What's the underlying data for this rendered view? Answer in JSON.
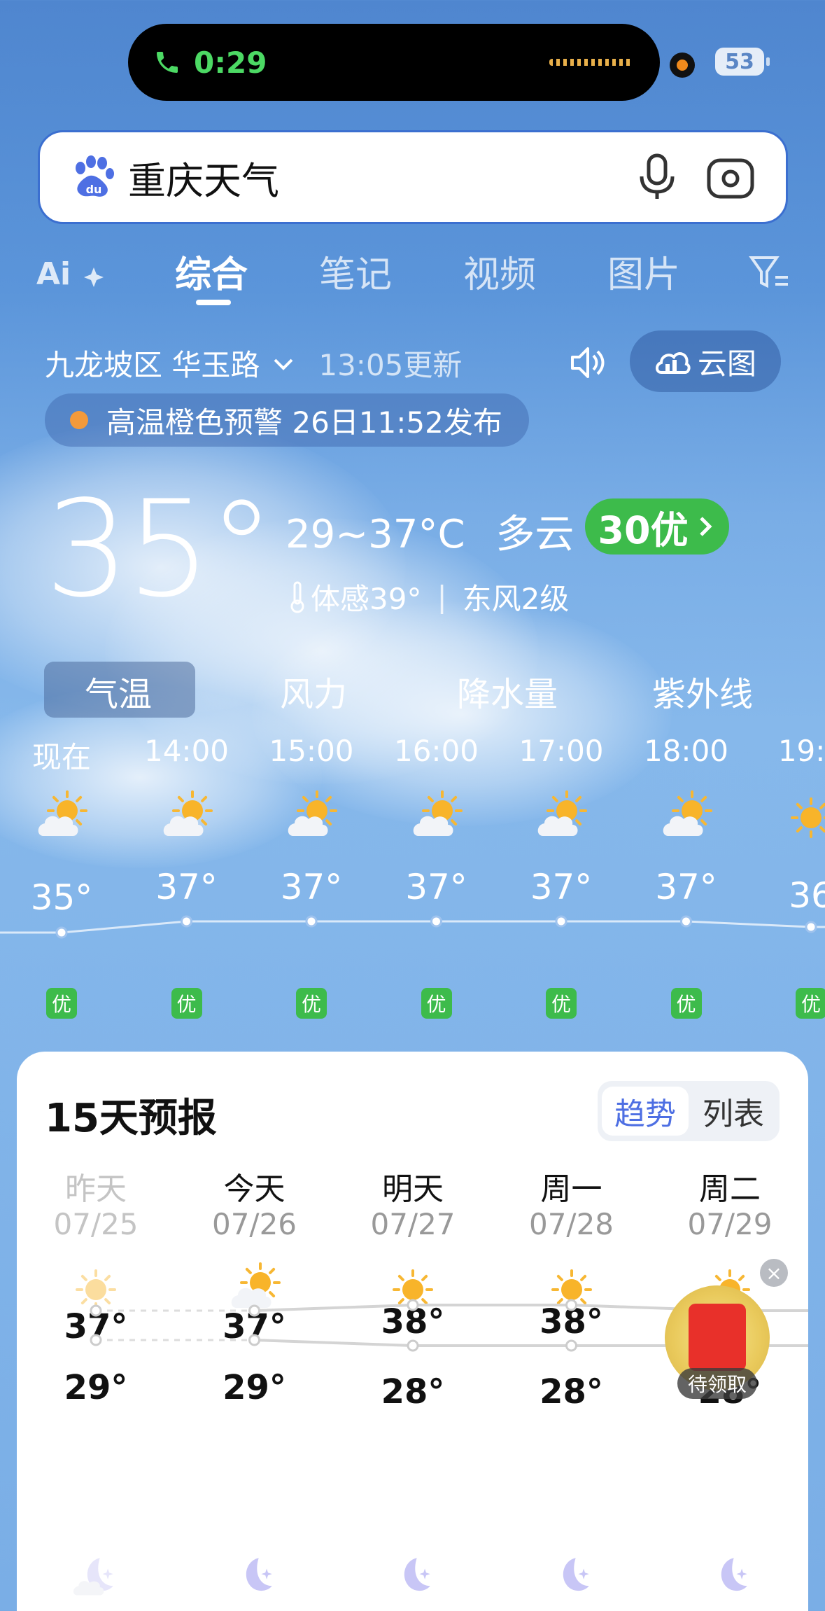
{
  "status": {
    "call_time": "0:29",
    "battery": "53"
  },
  "search": {
    "query": "重庆天气"
  },
  "tabs": [
    {
      "label": "综合",
      "active": true
    },
    {
      "label": "笔记",
      "active": false
    },
    {
      "label": "视频",
      "active": false
    },
    {
      "label": "图片",
      "active": false
    }
  ],
  "location": {
    "name": "九龙坡区 华玉路",
    "updated": "13:05更新",
    "cloud_map": "云图"
  },
  "alert": {
    "text": "高温橙色预警 26日11:52发布",
    "color": "#f39a3b"
  },
  "current": {
    "temp": "35°",
    "range": "29~37°C",
    "condition": "多云",
    "aqi": "30优",
    "feels": "体感39°",
    "wind": "东风2级"
  },
  "metric_tabs": [
    "气温",
    "风力",
    "降水量",
    "紫外线"
  ],
  "hourly": [
    {
      "time": "现在",
      "temp": "35°",
      "aqi": "优",
      "icon": "partly-cloudy-icon"
    },
    {
      "time": "14:00",
      "temp": "37°",
      "aqi": "优",
      "icon": "partly-cloudy-icon"
    },
    {
      "time": "15:00",
      "temp": "37°",
      "aqi": "优",
      "icon": "partly-cloudy-icon"
    },
    {
      "time": "16:00",
      "temp": "37°",
      "aqi": "优",
      "icon": "partly-cloudy-icon"
    },
    {
      "time": "17:00",
      "temp": "37°",
      "aqi": "优",
      "icon": "partly-cloudy-icon"
    },
    {
      "time": "18:00",
      "temp": "37°",
      "aqi": "优",
      "icon": "partly-cloudy-icon"
    },
    {
      "time": "19:0",
      "temp": "36",
      "aqi": "优",
      "icon": "sun-icon"
    }
  ],
  "forecast": {
    "title": "15天预报",
    "view_trend": "趋势",
    "view_list": "列表",
    "days": [
      {
        "name": "昨天",
        "date": "07/25",
        "high": "37°",
        "low": "29°",
        "past": true,
        "day_icon": "sun-icon",
        "night_icon": "moon-cloud-icon"
      },
      {
        "name": "今天",
        "date": "07/26",
        "high": "37°",
        "low": "29°",
        "past": false,
        "day_icon": "partly-cloudy-icon",
        "night_icon": "moon-icon"
      },
      {
        "name": "明天",
        "date": "07/27",
        "high": "38°",
        "low": "28°",
        "past": false,
        "day_icon": "sun-icon",
        "night_icon": "moon-icon"
      },
      {
        "name": "周一",
        "date": "07/28",
        "high": "38°",
        "low": "28°",
        "past": false,
        "day_icon": "sun-icon",
        "night_icon": "moon-icon"
      },
      {
        "name": "周二",
        "date": "07/29",
        "high": "",
        "low": "28°",
        "past": false,
        "day_icon": "sun-icon",
        "night_icon": "moon-icon"
      }
    ]
  },
  "promo": {
    "label": "待领取"
  }
}
